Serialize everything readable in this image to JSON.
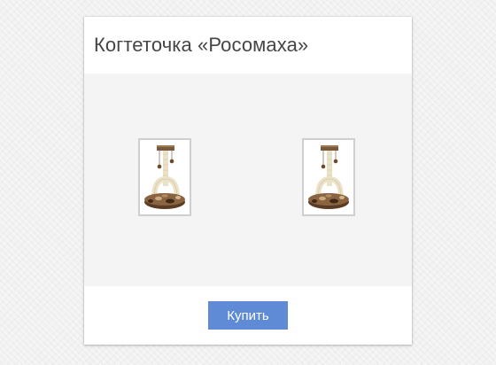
{
  "product": {
    "title": "Когтеточка «Росомаха»"
  },
  "gallery": {
    "images": [
      {
        "icon": "cat-scratching-post-image"
      },
      {
        "icon": "cat-scratching-post-image"
      }
    ]
  },
  "actions": {
    "buy_label": "Купить"
  },
  "colors": {
    "button": "#5f8bd6",
    "gallery_background": "#f4f4f4",
    "title_text": "#454545"
  }
}
